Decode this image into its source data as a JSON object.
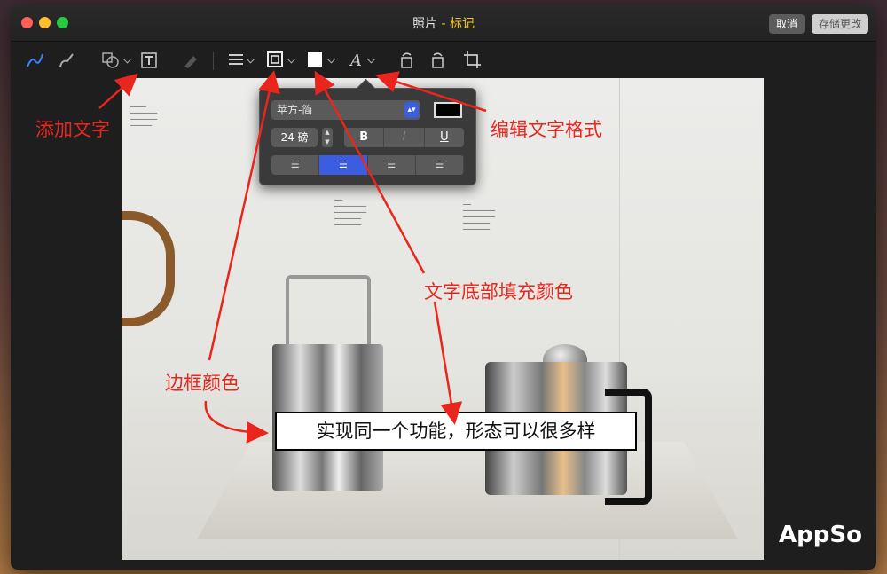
{
  "window": {
    "title_main": "照片",
    "title_sep": " - ",
    "title_mode": "标记",
    "cancel_label": "取消",
    "save_label": "存储更改"
  },
  "toolbar": {
    "icons": [
      "sketch-icon",
      "draw-icon",
      "shapes-icon",
      "text-icon",
      "highlight-icon",
      "line-style-icon",
      "border-color-icon",
      "fill-color-icon",
      "text-style-icon",
      "rotate-left-icon",
      "rotate-right-icon",
      "crop-icon"
    ]
  },
  "text_style_popover": {
    "font": "苹方-简",
    "size": "24 磅",
    "bold": "B",
    "italic": "I",
    "underline": "U",
    "text_color": "#000000"
  },
  "annotations": {
    "add_text": "添加文字",
    "edit_text_format": "编辑文字格式",
    "fill_color": "文字底部填充颜色",
    "border_color": "边框颜色"
  },
  "canvas_textbox": "实现同一个功能，形态可以很多样",
  "watermark": "AppSo",
  "colors": {
    "accent": "#f5c518",
    "annotation": "#e8261d",
    "selection": "#3d5de0"
  }
}
